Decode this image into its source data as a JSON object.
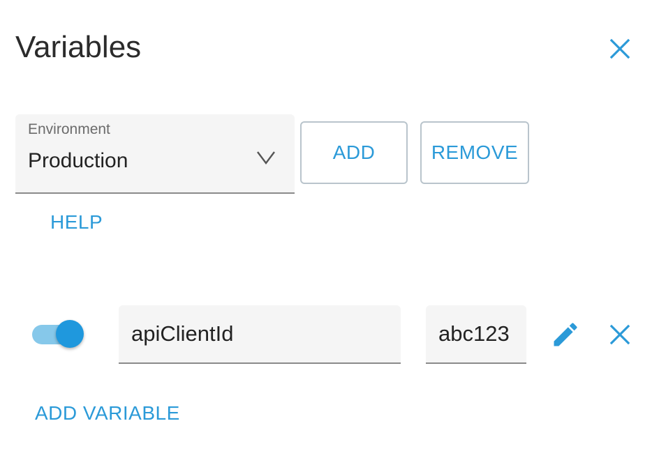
{
  "dialog": {
    "title": "Variables"
  },
  "environment": {
    "label": "Environment",
    "selected": "Production"
  },
  "actions": {
    "add_label": "ADD",
    "remove_label": "REMOVE",
    "help_label": "HELP",
    "add_variable_label": "ADD VARIABLE"
  },
  "variables": [
    {
      "enabled": true,
      "name": "apiClientId",
      "value": "abc123"
    }
  ],
  "icons": {
    "close": "close-icon",
    "chevron": "chevron-down-icon",
    "edit": "pencil-icon",
    "delete": "close-icon"
  },
  "colors": {
    "accent": "#2b9ad8",
    "toggle_track": "#86c8ea",
    "toggle_thumb": "#1f98dd",
    "field_bg": "#f5f5f5"
  }
}
